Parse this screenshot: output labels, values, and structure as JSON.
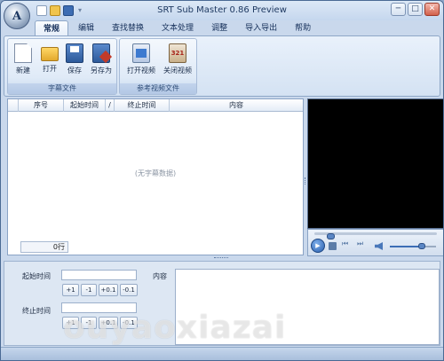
{
  "window": {
    "title": "SRT Sub Master 0.86 Preview",
    "minimize": "─",
    "maximize": "□",
    "close": "✕"
  },
  "app_orb": {
    "letter": "A"
  },
  "tabs": [
    {
      "label": "常规",
      "active": true
    },
    {
      "label": "编辑"
    },
    {
      "label": "查找替换"
    },
    {
      "label": "文本处理"
    },
    {
      "label": "调整"
    },
    {
      "label": "导入导出"
    },
    {
      "label": "帮助"
    }
  ],
  "ribbon": {
    "subtitle_group": {
      "label": "字幕文件",
      "buttons": [
        {
          "label": "新建",
          "icon": "new-file-icon"
        },
        {
          "label": "打开",
          "icon": "open-folder-icon"
        },
        {
          "label": "保存",
          "icon": "save-disk-icon"
        },
        {
          "label": "另存为",
          "icon": "save-as-icon"
        }
      ]
    },
    "video_group": {
      "label": "参考视频文件",
      "buttons": [
        {
          "label": "打开视频",
          "icon": "open-video-icon"
        },
        {
          "label": "关闭视频",
          "icon": "close-video-icon"
        }
      ]
    }
  },
  "subtitle_list": {
    "columns": [
      "序号",
      "起始时间",
      "/",
      "终止时间",
      "内容"
    ],
    "empty_text": "(无字幕数据)",
    "row_count": "0行"
  },
  "editor": {
    "start_label": "起始时间",
    "end_label": "终止时间",
    "content_label": "内容",
    "adjust_buttons": [
      "+1",
      "-1",
      "+0.1",
      "-0.1"
    ]
  },
  "watermark": "ouyaoxiazai",
  "colors": {
    "accent": "#3d6eb6",
    "ribbon_bg": "#d4e2f3",
    "window_bg": "#c9d8ec"
  }
}
